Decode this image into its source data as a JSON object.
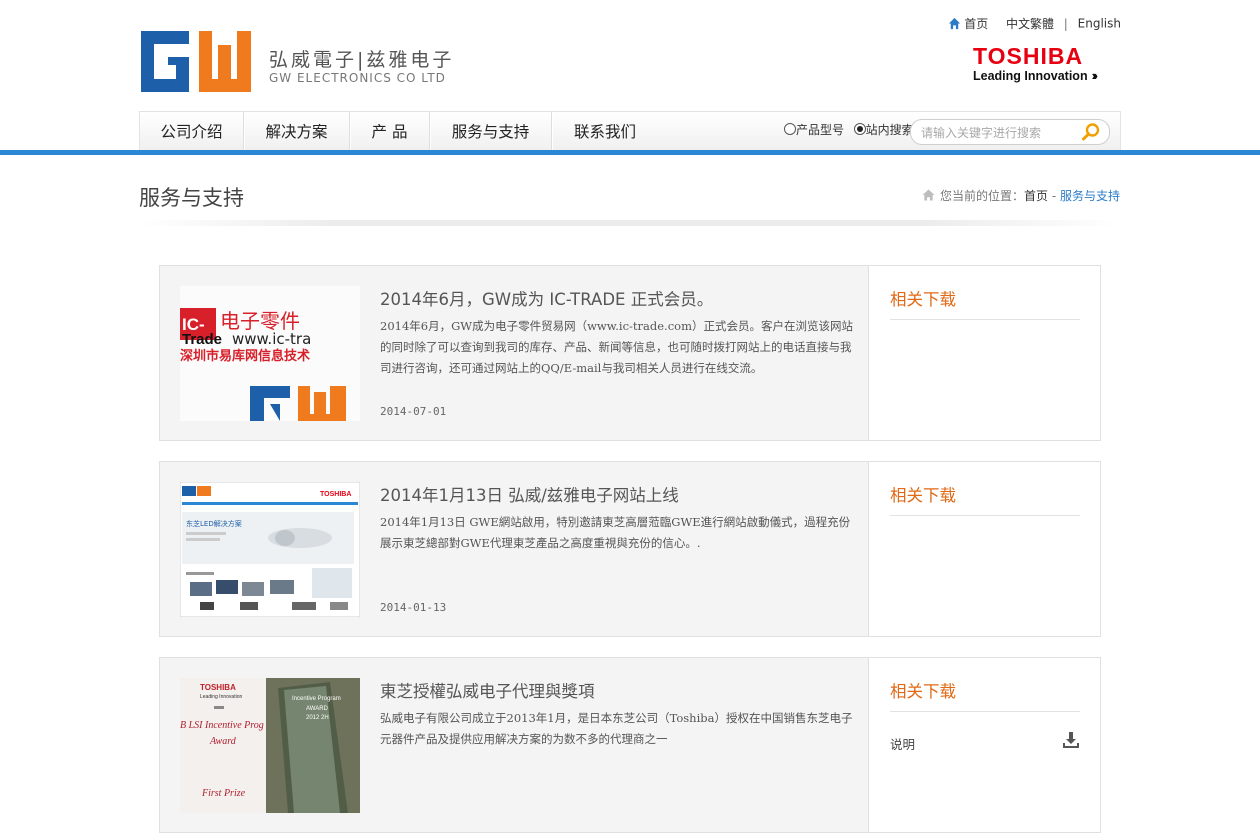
{
  "header": {
    "logo_cn": "弘威電子|兹雅电子",
    "logo_en": "GW ELECTRONICS CO LTD",
    "top_links": {
      "home": "首页",
      "trad": "中文繁體",
      "sep": "|",
      "english": "English"
    },
    "partner": {
      "name": "TOSHIBA",
      "tagline": "Leading Innovation"
    }
  },
  "nav": {
    "items": [
      "公司介绍",
      "解决方案",
      "产 品",
      "服务与支持",
      "联系我们"
    ]
  },
  "search": {
    "option_product": "产品型号",
    "option_site": "站内搜索",
    "selected": "站内搜索",
    "placeholder": "请输入关键字进行搜索"
  },
  "page": {
    "title": "服务与支持",
    "breadcrumb_prefix": "您当前的位置：",
    "breadcrumb_home": "首页",
    "breadcrumb_sep": " - ",
    "breadcrumb_current": "服务与支持"
  },
  "cards": [
    {
      "title": "2014年6月，GW成为 IC-TRADE 正式会员。",
      "desc": "2014年6月，GW成为电子零件贸易网（www.ic-trade.com）正式会员。客户在浏览该网站的同时除了可以查询到我司的库存、产品、新闻等信息，也可随时拨打网站上的电话直接与我司进行咨询，还可通过网站上的QQ/E-mail与我司相关人员进行在线交流。",
      "date": "2014-07-01",
      "side_title": "相关下载",
      "downloads": [],
      "thumb": {
        "label1": "IC-",
        "label2": "Trade",
        "heading": "电子零件",
        "url": "www.ic-tra",
        "company": "深圳市易库网信息技术"
      }
    },
    {
      "title": "2014年1月13日 弘威/兹雅电子网站上线",
      "desc": "2014年1月13日 GWE網站啟用，特別邀請東芝高層蒞臨GWE進行網站啟動儀式，過程充份展示東芝總部對GWE代理東芝產品之高度重視與充份的信心。.",
      "date": "2014-01-13",
      "side_title": "相关下载",
      "downloads": [],
      "thumb": {
        "brand": "TOSHIBA",
        "banner": "东芝LED解决方案"
      }
    },
    {
      "title": "東芝授權弘威电子代理與獎項",
      "desc": "弘威电子有限公司成立于2013年1月，是日本东芝公司（Toshiba）授权在中国销售东芝电子元器件产品及提供应用解决方案的为数不多的代理商之一",
      "date": "",
      "side_title": "相关下载",
      "downloads": [
        "说明"
      ],
      "thumb": {
        "brand": "TOSHIBA",
        "tag": "Leading Innovation",
        "line1": "B LSI Incentive Prog",
        "line2": "Award",
        "line3": "First Prize",
        "line4": "Incentive Program",
        "line5": "AWARD",
        "line6": "2012 2H"
      }
    }
  ],
  "colors": {
    "brand_blue": "#1d5fa8",
    "brand_orange": "#f07a1e",
    "nav_underline": "#2b86d6",
    "download_title": "#e06a16",
    "toshiba_red": "#e60012"
  },
  "icons": [
    "home-icon",
    "search-icon",
    "download-icon"
  ]
}
